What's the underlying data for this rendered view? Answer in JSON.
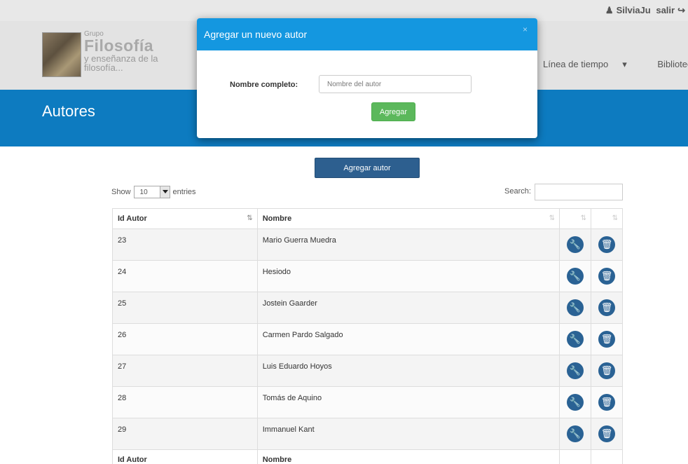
{
  "user": {
    "name": "SilviaJu",
    "logout_label": "salir",
    "user_icon": "user-icon",
    "logout_icon": "logout-icon"
  },
  "logo": {
    "line1": "Grupo",
    "line2": "Filosofía",
    "line3": "y enseñanza de la",
    "line4": "filosofía..."
  },
  "nav": {
    "items": [
      {
        "label": "Línea de tiempo"
      },
      {
        "label": "Biblioteca"
      }
    ],
    "caret": "▾"
  },
  "banner": {
    "title": "Autores"
  },
  "actions": {
    "add_author_label": "Agregar autor"
  },
  "table_controls": {
    "show_label": "Show",
    "length_value": "10",
    "entries_label": "entries",
    "search_label": "Search:"
  },
  "table": {
    "headers": {
      "id": "Id Autor",
      "nombre": "Nombre"
    },
    "rows": [
      {
        "id": "23",
        "nombre": "Mario Guerra Muedra"
      },
      {
        "id": "24",
        "nombre": "Hesiodo"
      },
      {
        "id": "25",
        "nombre": "Jostein Gaarder"
      },
      {
        "id": "26",
        "nombre": "Carmen Pardo Salgado"
      },
      {
        "id": "27",
        "nombre": "Luis Eduardo Hoyos"
      },
      {
        "id": "28",
        "nombre": "Tomás de Aquino"
      },
      {
        "id": "29",
        "nombre": "Immanuel Kant"
      }
    ],
    "footer": {
      "id": "Id Autor",
      "nombre": "Nombre"
    },
    "edit_icon": "wrench-icon",
    "delete_icon": "trash-icon"
  },
  "modal": {
    "title": "Agregar un nuevo autor",
    "close": "×",
    "field_label": "Nombre completo:",
    "field_placeholder": "Nombre del autor",
    "field_value": "",
    "submit_label": "Agregar"
  },
  "colors": {
    "banner": "#0d7bc0",
    "modal_header": "#1497e0",
    "submit": "#5cb85c",
    "action_button": "#2a6294",
    "add_button": "#2d5f8f"
  }
}
